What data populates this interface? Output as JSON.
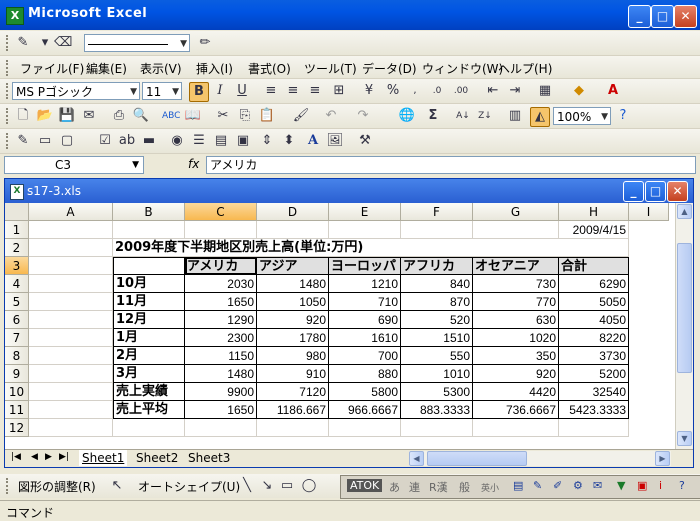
{
  "app": {
    "title": "Microsoft Excel"
  },
  "menu": [
    "ファイル(F)",
    "編集(E)",
    "表示(V)",
    "挿入(I)",
    "書式(O)",
    "ツール(T)",
    "データ(D)",
    "ウィンドウ(W)",
    "ヘルプ(H)"
  ],
  "format_bar": {
    "font": "MS Pゴシック",
    "size": "11",
    "zoom": "100%"
  },
  "formula_bar": {
    "name_box": "C3",
    "fx": "fx",
    "content": "アメリカ"
  },
  "workbook": {
    "title": "s17-3.xls"
  },
  "columns": [
    "A",
    "B",
    "C",
    "D",
    "E",
    "F",
    "G",
    "H",
    "I"
  ],
  "rows": [
    "1",
    "2",
    "3",
    "4",
    "5",
    "6",
    "7",
    "8",
    "9",
    "10",
    "11",
    "12"
  ],
  "sheet": {
    "date": "2009/4/15",
    "title": "2009年度下半期地区別売上高(単位:万円)",
    "headers": [
      "アメリカ",
      "アジア",
      "ヨーロッパ",
      "アフリカ",
      "オセアニア",
      "合計"
    ],
    "data_rows": [
      {
        "label": "10月",
        "values": [
          "2030",
          "1480",
          "1210",
          "840",
          "730",
          "6290"
        ]
      },
      {
        "label": "11月",
        "values": [
          "1650",
          "1050",
          "710",
          "870",
          "770",
          "5050"
        ]
      },
      {
        "label": "12月",
        "values": [
          "1290",
          "920",
          "690",
          "520",
          "630",
          "4050"
        ]
      },
      {
        "label": "1月",
        "values": [
          "2300",
          "1780",
          "1610",
          "1510",
          "1020",
          "8220"
        ]
      },
      {
        "label": "2月",
        "values": [
          "1150",
          "980",
          "700",
          "550",
          "350",
          "3730"
        ]
      },
      {
        "label": "3月",
        "values": [
          "1480",
          "910",
          "880",
          "1010",
          "920",
          "5200"
        ]
      },
      {
        "label": "売上実績",
        "values": [
          "9900",
          "7120",
          "5800",
          "5300",
          "4420",
          "32540"
        ]
      },
      {
        "label": "売上平均",
        "values": [
          "1650",
          "1186.667",
          "966.6667",
          "883.3333",
          "736.6667",
          "5423.3333"
        ]
      }
    ]
  },
  "tabs": [
    "Sheet1",
    "Sheet2",
    "Sheet3"
  ],
  "drawing_bar": {
    "adjust": "図形の調整(R)",
    "autoshape": "オートシェイプ(U)"
  },
  "ime": {
    "atok": "ATOK",
    "a": "あ",
    "ren": "連",
    "r": "R漢",
    "ban": "般",
    "eisu": "英小"
  },
  "status": "コマンド"
}
